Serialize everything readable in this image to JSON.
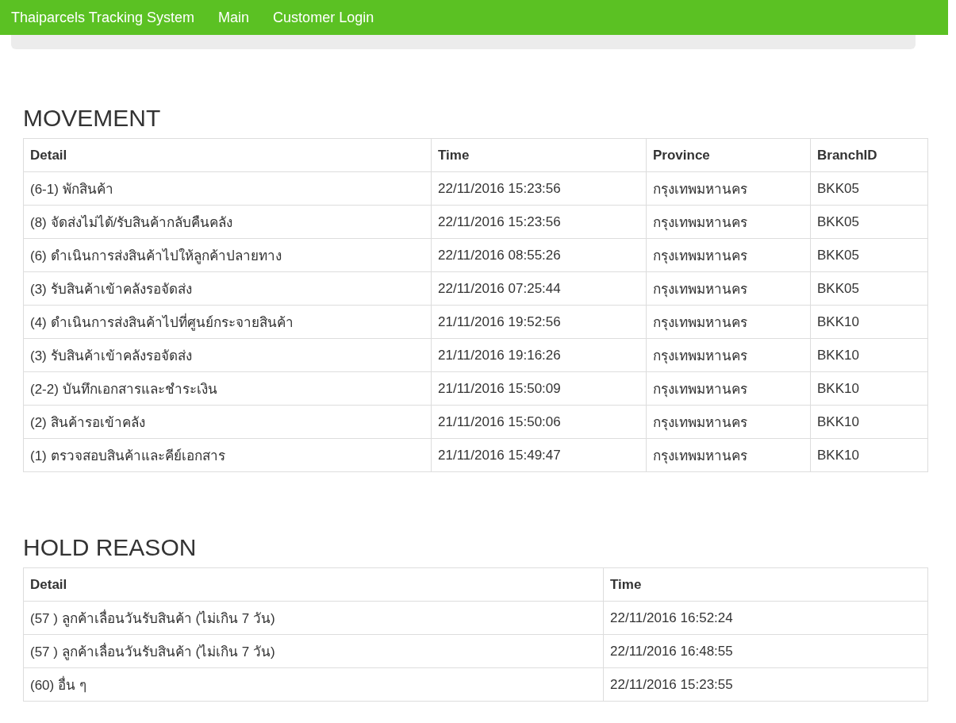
{
  "navbar": {
    "brand": "Thaiparcels Tracking System",
    "links": [
      "Main",
      "Customer Login"
    ]
  },
  "movement": {
    "title": "MOVEMENT",
    "columns": [
      "Detail",
      "Time",
      "Province",
      "BranchID"
    ],
    "rows": [
      [
        "(6-1) พักสินค้า",
        "22/11/2016 15:23:56",
        "กรุงเทพมหานคร",
        "BKK05"
      ],
      [
        "(8) จัดส่งไม่ได้/รับสินค้ากลับคืนคลัง",
        "22/11/2016 15:23:56",
        "กรุงเทพมหานคร",
        "BKK05"
      ],
      [
        "(6) ดำเนินการส่งสินค้าไปให้ลูกค้าปลายทาง",
        "22/11/2016 08:55:26",
        "กรุงเทพมหานคร",
        "BKK05"
      ],
      [
        "(3) รับสินค้าเข้าคลังรอจัดส่ง",
        "22/11/2016 07:25:44",
        "กรุงเทพมหานคร",
        "BKK05"
      ],
      [
        "(4) ดำเนินการส่งสินค้าไปที่ศูนย์กระจายสินค้า",
        "21/11/2016 19:52:56",
        "กรุงเทพมหานคร",
        "BKK10"
      ],
      [
        "(3) รับสินค้าเข้าคลังรอจัดส่ง",
        "21/11/2016 19:16:26",
        "กรุงเทพมหานคร",
        "BKK10"
      ],
      [
        "(2-2) บันทึกเอกสารและชำระเงิน",
        "21/11/2016 15:50:09",
        "กรุงเทพมหานคร",
        "BKK10"
      ],
      [
        "(2) สินค้ารอเข้าคลัง",
        "21/11/2016 15:50:06",
        "กรุงเทพมหานคร",
        "BKK10"
      ],
      [
        "(1) ตรวจสอบสินค้าและคีย์เอกสาร",
        "21/11/2016 15:49:47",
        "กรุงเทพมหานคร",
        "BKK10"
      ]
    ]
  },
  "hold_reason": {
    "title": "HOLD REASON",
    "columns": [
      "Detail",
      "Time"
    ],
    "rows": [
      [
        "(57 ) ลูกค้าเลื่อนวันรับสินค้า (ไม่เกิน 7 วัน)",
        "22/11/2016 16:52:24"
      ],
      [
        "(57 ) ลูกค้าเลื่อนวันรับสินค้า (ไม่เกิน 7 วัน)",
        "22/11/2016 16:48:55"
      ],
      [
        "(60) อื่น ๆ",
        "22/11/2016 15:23:55"
      ]
    ]
  }
}
